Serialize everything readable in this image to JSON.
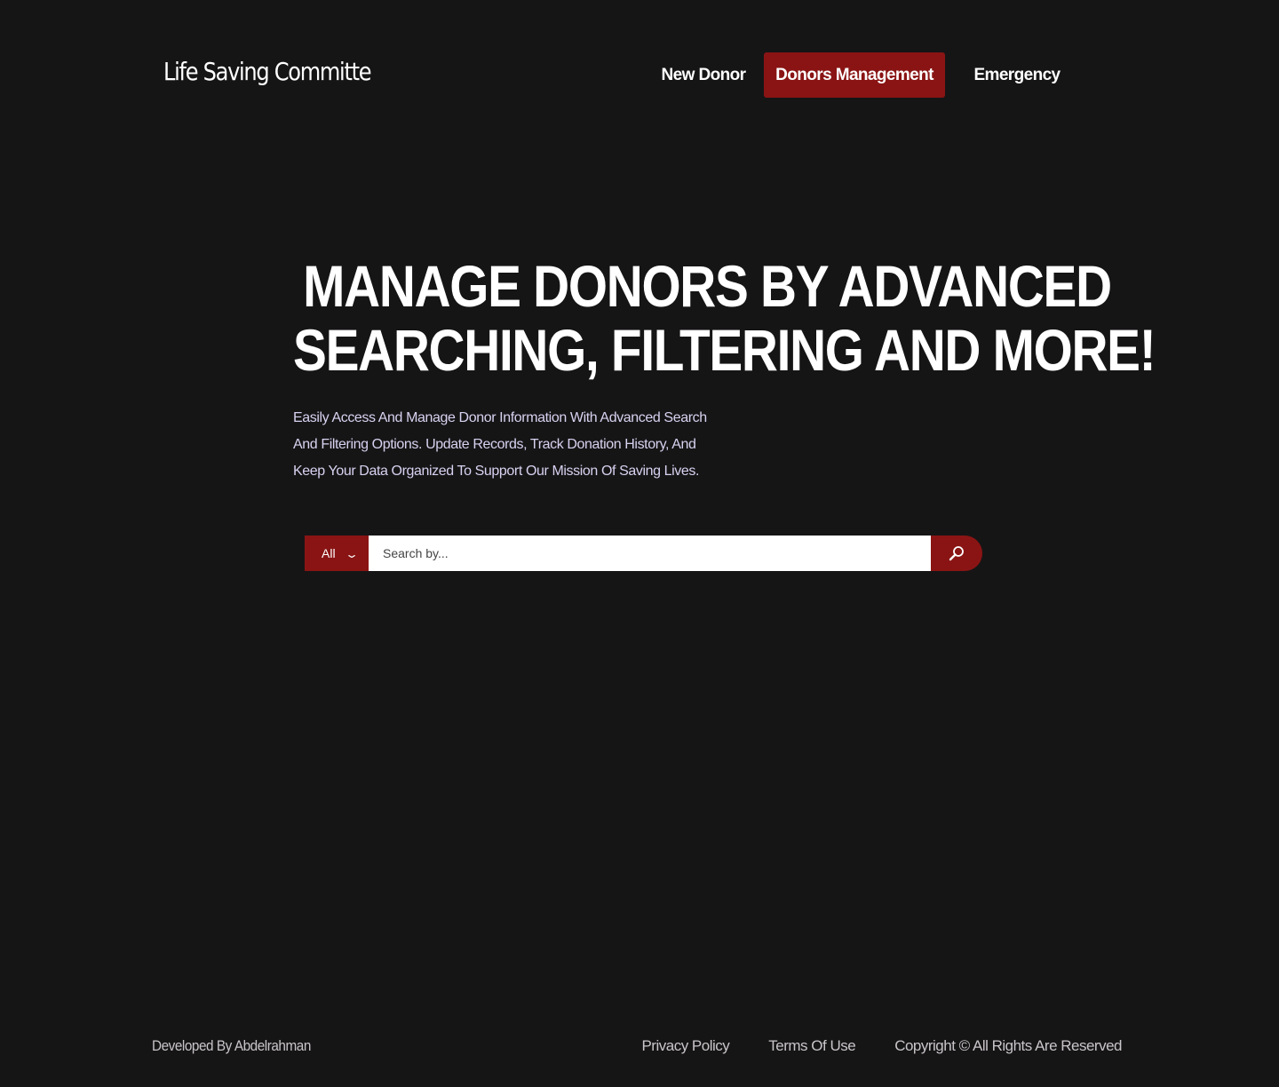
{
  "brand": {
    "title": "Life Saving Committe"
  },
  "nav": {
    "items": [
      {
        "label": "New Donor",
        "active": false
      },
      {
        "label": "Donors Management",
        "active": true
      },
      {
        "label": "Emergency",
        "active": false
      }
    ]
  },
  "hero": {
    "title_line1": "MANAGE DONORS BY ADVANCED",
    "title_line2": "SEARCHING, FILTERING AND MORE!",
    "description": "Easily Access And Manage Donor Information With Advanced Search And Filtering Options. Update Records, Track Donation History, And Keep Your Data Organized To Support Our Mission Of Saving Lives."
  },
  "search": {
    "filter_value": "All",
    "placeholder": "Search by...",
    "value": ""
  },
  "footer": {
    "developer": "Developed By Abdelrahman",
    "privacy": "Privacy Policy",
    "terms": "Terms Of Use",
    "copyright": "Copyright © All Rights Are Reserved"
  },
  "colors": {
    "background": "#161516",
    "accent": "#8a1414",
    "text": "#ffffff",
    "description_text": "#d8d2f0",
    "footer_text": "#c9c5c9"
  },
  "icons": {
    "dropdown": "chevron-down-icon",
    "search": "search-icon"
  }
}
